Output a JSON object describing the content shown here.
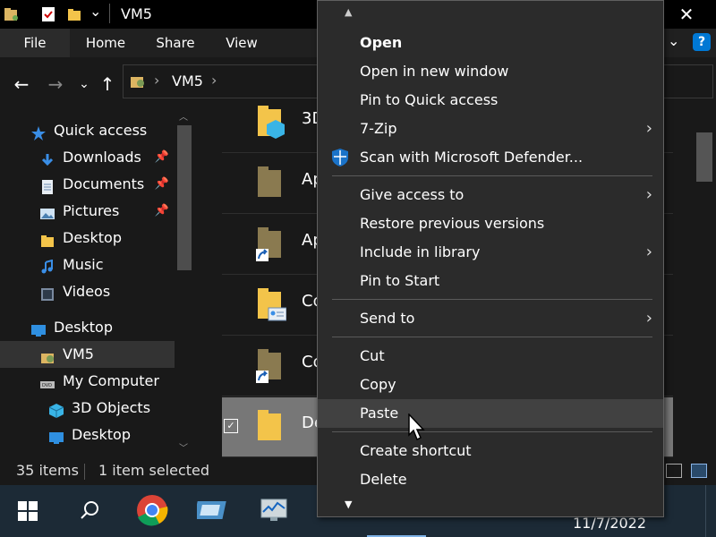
{
  "window": {
    "title": "VM5"
  },
  "title_bar": {
    "close_glyph": "✕",
    "qat_down_glyph": "⌄"
  },
  "ribbon": {
    "tabs": [
      "File",
      "Home",
      "Share",
      "View"
    ],
    "help_glyph": "?",
    "collapse_glyph": "⌄"
  },
  "nav_buttons": {
    "back": "←",
    "forward": "→",
    "recent": "⌄",
    "up": "↑"
  },
  "address": {
    "path": "VM5",
    "separator": "›"
  },
  "nav_pane": {
    "items": [
      {
        "label": "Quick access",
        "icon": "star-icon",
        "pinned": false
      },
      {
        "label": "Downloads",
        "icon": "download-icon",
        "pinned": true
      },
      {
        "label": "Documents",
        "icon": "document-icon",
        "pinned": true
      },
      {
        "label": "Pictures",
        "icon": "pictures-icon",
        "pinned": true
      },
      {
        "label": "Desktop",
        "icon": "folder-icon",
        "pinned": false
      },
      {
        "label": "Music",
        "icon": "music-icon",
        "pinned": false
      },
      {
        "label": "Videos",
        "icon": "videos-icon",
        "pinned": false
      },
      {
        "label": "Desktop",
        "icon": "desktop-icon",
        "pinned": false
      },
      {
        "label": "VM5",
        "icon": "user-folder-icon",
        "pinned": false,
        "selected": true
      },
      {
        "label": "My Computer",
        "icon": "dvd-drive-icon",
        "pinned": false
      },
      {
        "label": "3D Objects",
        "icon": "cube-icon",
        "pinned": false
      },
      {
        "label": "Desktop",
        "icon": "desktop-icon",
        "pinned": false
      }
    ],
    "pin_glyph": "📌"
  },
  "file_list": {
    "rows": [
      {
        "name": "3D",
        "icon": "folder-3d-icon"
      },
      {
        "name": "Ap",
        "icon": "folder-icon"
      },
      {
        "name": "Ap",
        "icon": "folder-shortcut-icon"
      },
      {
        "name": "Co",
        "icon": "folder-contacts-icon"
      },
      {
        "name": "Co",
        "icon": "folder-shortcut-icon"
      },
      {
        "name": "De",
        "icon": "folder-icon",
        "selected": true
      }
    ]
  },
  "status": {
    "items": "35 items",
    "selected": "1 item selected"
  },
  "context_menu": {
    "scroll_up": "▲",
    "scroll_down": "▼",
    "groups": [
      [
        {
          "label": "Open",
          "bold": true
        },
        {
          "label": "Open in new window"
        },
        {
          "label": "Pin to Quick access"
        },
        {
          "label": "7-Zip",
          "submenu": true
        },
        {
          "label": "Scan with Microsoft Defender...",
          "icon": "defender-shield-icon"
        }
      ],
      [
        {
          "label": "Give access to",
          "submenu": true
        },
        {
          "label": "Restore previous versions"
        },
        {
          "label": "Include in library",
          "submenu": true
        },
        {
          "label": "Pin to Start"
        }
      ],
      [
        {
          "label": "Send to",
          "submenu": true
        }
      ],
      [
        {
          "label": "Cut"
        },
        {
          "label": "Copy"
        },
        {
          "label": "Paste",
          "hover": true
        }
      ],
      [
        {
          "label": "Create shortcut"
        },
        {
          "label": "Delete"
        }
      ]
    ],
    "submenu_glyph": "›"
  },
  "taskbar": {
    "icons": [
      "windows-start-icon",
      "search-icon",
      "chrome-icon",
      "app-icon",
      "monitor-app-icon"
    ],
    "clock": "11/7/2022"
  },
  "colors": {
    "accent": "#0078d4",
    "background": "#191919",
    "menu": "#2b2b2b",
    "highlight": "#414141"
  }
}
